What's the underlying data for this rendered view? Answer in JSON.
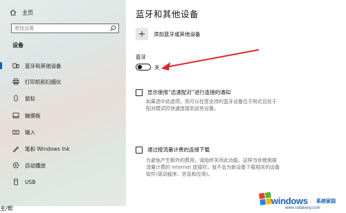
{
  "sidebar": {
    "home_label": "主页",
    "search_placeholder": "查找设置",
    "section_title": "设备",
    "items": [
      {
        "label": "蓝牙和其他设备",
        "icon": "bluetooth-icon",
        "active": true
      },
      {
        "label": "打印机和扫描仪",
        "icon": "printer-icon"
      },
      {
        "label": "鼠标",
        "icon": "mouse-icon"
      },
      {
        "label": "触摸板",
        "icon": "touchpad-icon"
      },
      {
        "label": "输入",
        "icon": "keyboard-icon"
      },
      {
        "label": "笔和 Windows Ink",
        "icon": "pen-icon"
      },
      {
        "label": "自动播放",
        "icon": "autoplay-icon"
      },
      {
        "label": "USB",
        "icon": "usb-icon"
      }
    ],
    "bottom_partial": "主/帮"
  },
  "main": {
    "title": "蓝牙和其他设备",
    "add_device_label": "添加蓝牙或其他设备",
    "bluetooth_label": "蓝牙",
    "bluetooth_state": "关",
    "bluetooth_on": false,
    "swift_pair": {
      "label": "显示使用“迅速配对”进行连接的通知",
      "checked": false,
      "description_lines": [
        "如果选中此选项，则可以在受支持的蓝牙设备位于附近且处于",
        "配对模式时快速连接到这些设备。"
      ]
    },
    "metered": {
      "label": "通过按流量计费的连接下载",
      "checked": false,
      "description_lines": [
        "为避免产生额外的费用，请始终关闭此功能，这样当你使用按",
        "流量计费的 Internet 连接时，就不会为新设备下载相关的设备",
        "软件(驱动程序、信息和应用)。"
      ]
    }
  },
  "annotation": {
    "arrow_color": "#e0242a"
  },
  "watermark": {
    "brand": "windows",
    "cn": "系统家园",
    "url": "www.ruitaiwuy.com"
  },
  "colors": {
    "accent": "#0063b1"
  }
}
